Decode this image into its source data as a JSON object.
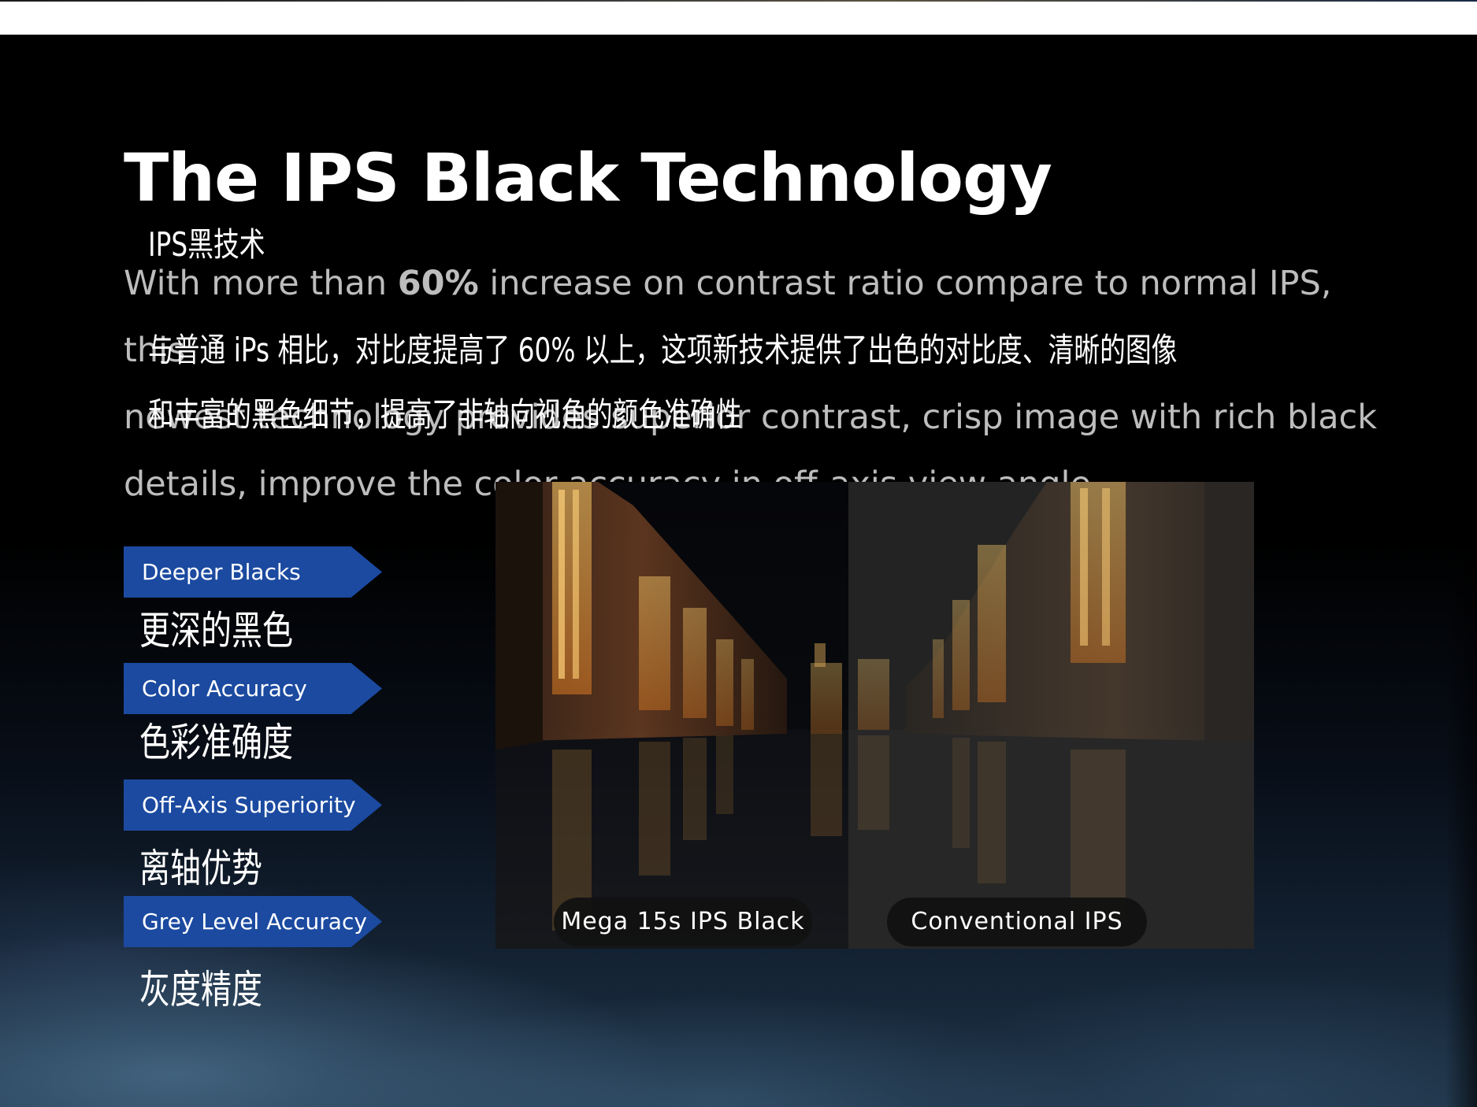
{
  "header": {
    "title": "The IPS Black Technology",
    "subtitle_cn": "IPS黑技术"
  },
  "intro": {
    "line1_prefix": "With more than ",
    "line1_bold": "60%",
    "line1_suffix": " increase on contrast ratio compare to normal IPS, this",
    "line2": "newest technology provides superior contrast, crisp image with rich black",
    "line3": "details, improve the color accuracy in off-axis view angle.",
    "cn_line1": "与普通 iPs 相比，对比度提高了 60% 以上，这项新技术提供了出色的对比度、清晰的图像",
    "cn_line2": "和丰富的黑色细节，提高了非轴向视角的颜色准确性"
  },
  "features": [
    {
      "label": "Deeper Blacks",
      "cn": "更深的黑色"
    },
    {
      "label": "Color Accuracy",
      "cn": "色彩准确度"
    },
    {
      "label": "Off-Axis Superiority",
      "cn": "离轴优势"
    },
    {
      "label": "Grey Level Accuracy",
      "cn": "灰度精度"
    }
  ],
  "comparison": {
    "left_label": "Mega 15s IPS Black",
    "right_label": "Conventional IPS"
  },
  "colors": {
    "accent_blue": "#1b4aa0",
    "background": "#000000",
    "body_text": "#bdbdbd"
  }
}
